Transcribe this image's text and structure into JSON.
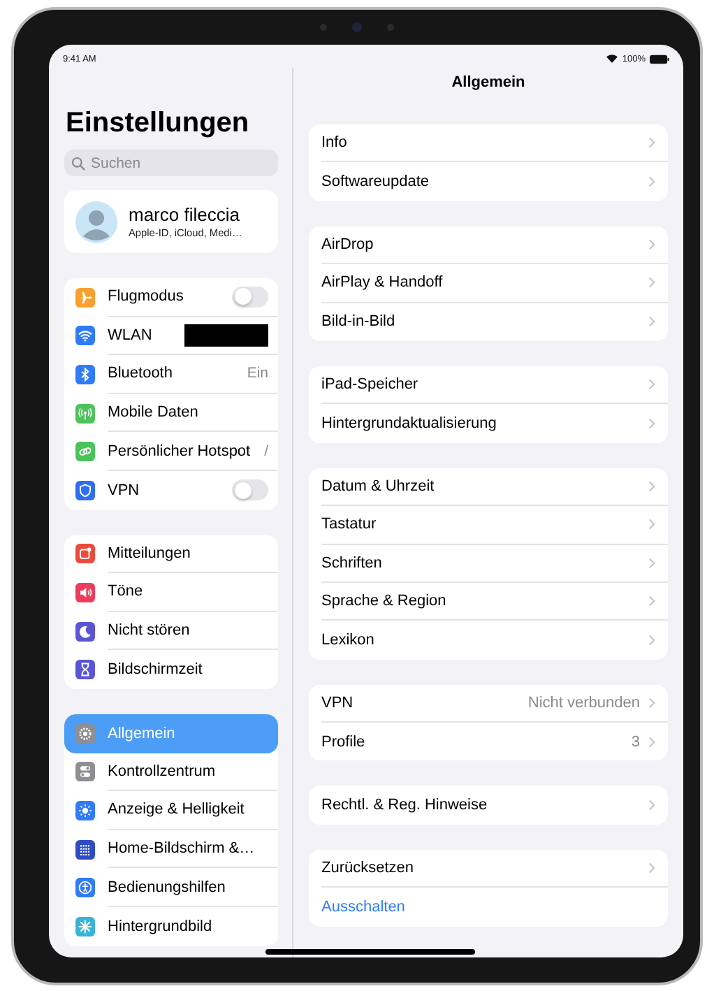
{
  "status_bar": {
    "time": "9:41 AM",
    "battery": "100%"
  },
  "sidebar": {
    "title": "Einstellungen",
    "search": {
      "placeholder": "Suchen"
    },
    "profile": {
      "name": "marco fileccia",
      "subtitle": "Apple-ID, iCloud, Medi…"
    },
    "groups": [
      {
        "items": [
          {
            "label": "Flugmodus",
            "kind": "toggle",
            "on": false,
            "color": "#f7a030",
            "selected": false
          },
          {
            "label": "WLAN",
            "kind": "redacted",
            "color": "#2f7cf6",
            "selected": false
          },
          {
            "label": "Bluetooth",
            "kind": "value",
            "value": "Ein",
            "color": "#2f7cf6",
            "selected": false
          },
          {
            "label": "Mobile Daten",
            "kind": "plain",
            "color": "#4cc35a",
            "selected": false
          },
          {
            "label": "Persönlicher Hotspot",
            "kind": "value",
            "value": "/",
            "color": "#4cc35a",
            "selected": false
          },
          {
            "label": "VPN",
            "kind": "toggle",
            "on": false,
            "color": "#2f6ef0",
            "selected": false
          }
        ]
      },
      {
        "items": [
          {
            "label": "Mitteilungen",
            "kind": "plain",
            "color": "#ec4b3c",
            "selected": false
          },
          {
            "label": "Töne",
            "kind": "plain",
            "color": "#ec3d5c",
            "selected": false
          },
          {
            "label": "Nicht stören",
            "kind": "plain",
            "color": "#5b55d6",
            "selected": false
          },
          {
            "label": "Bildschirmzeit",
            "kind": "plain",
            "color": "#5b55d6",
            "selected": false
          }
        ]
      },
      {
        "items": [
          {
            "label": "Allgemein",
            "kind": "plain",
            "color": "#8e8e93",
            "selected": true
          },
          {
            "label": "Kontrollzentrum",
            "kind": "plain",
            "color": "#8e8e93",
            "selected": false
          },
          {
            "label": "Anzeige & Helligkeit",
            "kind": "plain",
            "color": "#2f7cf6",
            "selected": false
          },
          {
            "label": "Home-Bildschirm &…",
            "kind": "plain",
            "color": "#2e4cc4",
            "selected": false
          },
          {
            "label": "Bedienungshilfen",
            "kind": "plain",
            "color": "#2f7cf6",
            "selected": false
          },
          {
            "label": "Hintergrundbild",
            "kind": "plain",
            "color": "#39b3d9",
            "selected": false
          }
        ]
      }
    ]
  },
  "detail": {
    "title": "Allgemein",
    "groups": [
      {
        "items": [
          {
            "label": "Info",
            "kind": "nav"
          },
          {
            "label": "Softwareupdate",
            "kind": "nav"
          }
        ]
      },
      {
        "items": [
          {
            "label": "AirDrop",
            "kind": "nav"
          },
          {
            "label": "AirPlay & Handoff",
            "kind": "nav"
          },
          {
            "label": "Bild-in-Bild",
            "kind": "nav"
          }
        ]
      },
      {
        "items": [
          {
            "label": "iPad-Speicher",
            "kind": "nav"
          },
          {
            "label": "Hintergrundaktualisierung",
            "kind": "nav"
          }
        ]
      },
      {
        "items": [
          {
            "label": "Datum & Uhrzeit",
            "kind": "nav"
          },
          {
            "label": "Tastatur",
            "kind": "nav"
          },
          {
            "label": "Schriften",
            "kind": "nav"
          },
          {
            "label": "Sprache & Region",
            "kind": "nav"
          },
          {
            "label": "Lexikon",
            "kind": "nav"
          }
        ]
      },
      {
        "items": [
          {
            "label": "VPN",
            "kind": "nav",
            "value": "Nicht verbunden"
          },
          {
            "label": "Profile",
            "kind": "nav",
            "value": "3"
          }
        ]
      },
      {
        "items": [
          {
            "label": "Rechtl. & Reg. Hinweise",
            "kind": "nav"
          }
        ]
      },
      {
        "items": [
          {
            "label": "Zurücksetzen",
            "kind": "nav"
          },
          {
            "label": "Ausschalten",
            "kind": "action"
          }
        ]
      }
    ]
  }
}
